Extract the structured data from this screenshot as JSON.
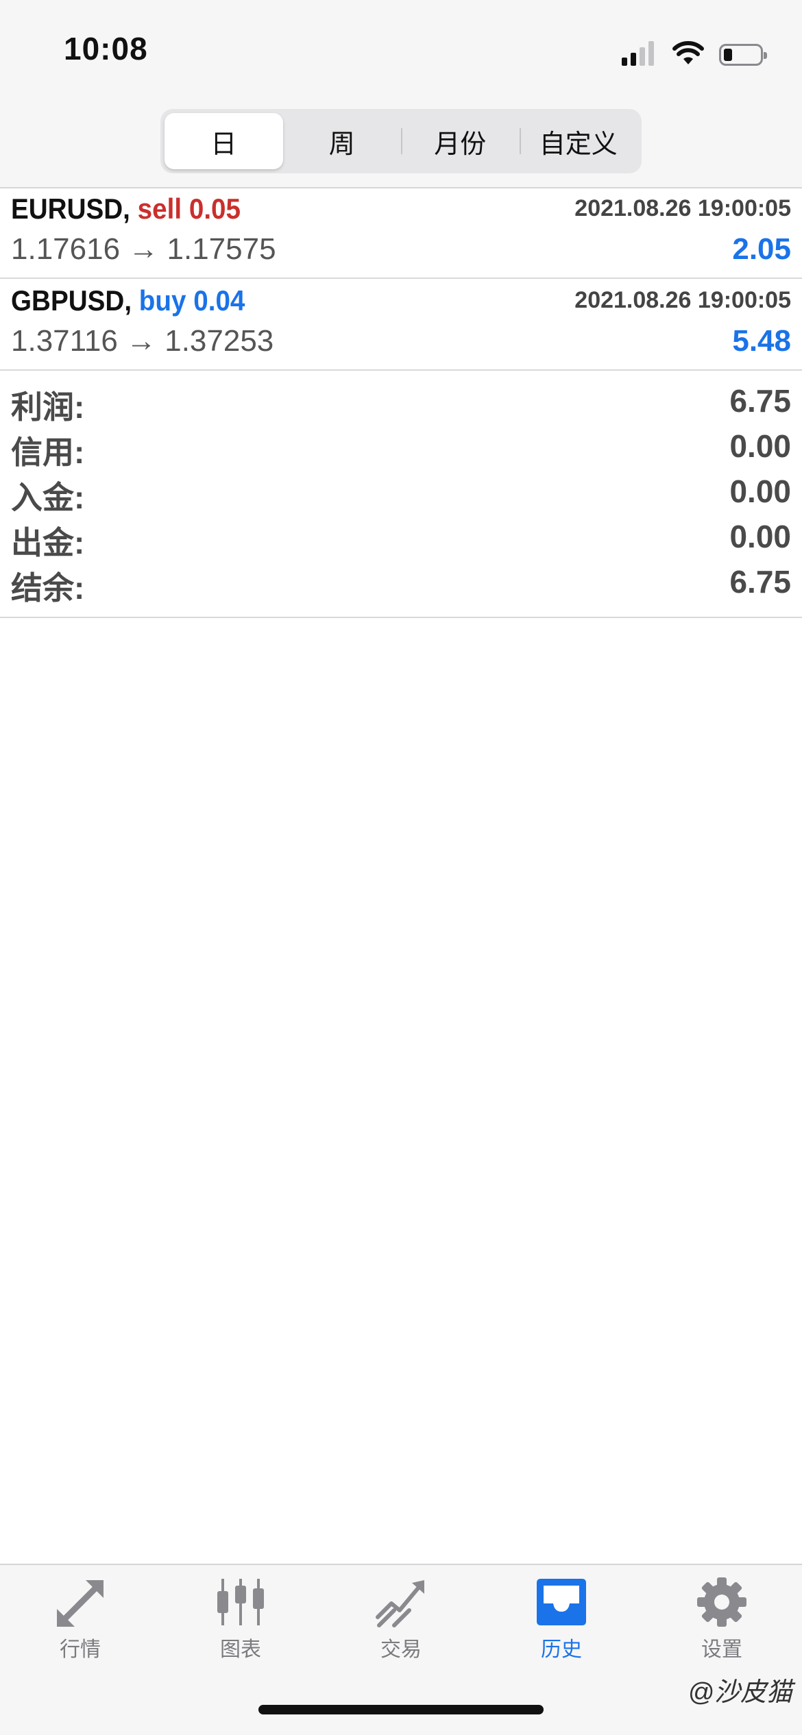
{
  "status_bar": {
    "time": "10:08"
  },
  "period_tabs": [
    {
      "label": "日",
      "selected": true
    },
    {
      "label": "周",
      "selected": false
    },
    {
      "label": "月份",
      "selected": false
    },
    {
      "label": "自定义",
      "selected": false
    }
  ],
  "trades": [
    {
      "symbol": "EURUSD,",
      "side_volume": "sell 0.05",
      "side": "sell",
      "time": "2021.08.26 19:00:05",
      "prices": "1.17616 → 1.17575",
      "profit": "2.05"
    },
    {
      "symbol": "GBPUSD,",
      "side_volume": "buy 0.04",
      "side": "buy",
      "time": "2021.08.26 19:00:05",
      "prices": "1.37116 → 1.37253",
      "profit": "5.48"
    }
  ],
  "summary": [
    {
      "label": "利润:",
      "value": "6.75"
    },
    {
      "label": "信用:",
      "value": "0.00"
    },
    {
      "label": "入金:",
      "value": "0.00"
    },
    {
      "label": "出金:",
      "value": "0.00"
    },
    {
      "label": "结余:",
      "value": "6.75"
    }
  ],
  "tabbar": [
    {
      "label": "行情",
      "icon": "quotes-arrows-icon",
      "active": false
    },
    {
      "label": "图表",
      "icon": "candlestick-chart-icon",
      "active": false
    },
    {
      "label": "交易",
      "icon": "trade-chart-icon",
      "active": false
    },
    {
      "label": "历史",
      "icon": "history-inbox-icon",
      "active": true
    },
    {
      "label": "设置",
      "icon": "gear-icon",
      "active": false
    }
  ],
  "watermark": "@沙皮猫",
  "colors": {
    "sell": "#c9302c",
    "buy": "#1a73e8",
    "accent": "#1a73e8",
    "inactive_tab": "#7b7b7f"
  }
}
